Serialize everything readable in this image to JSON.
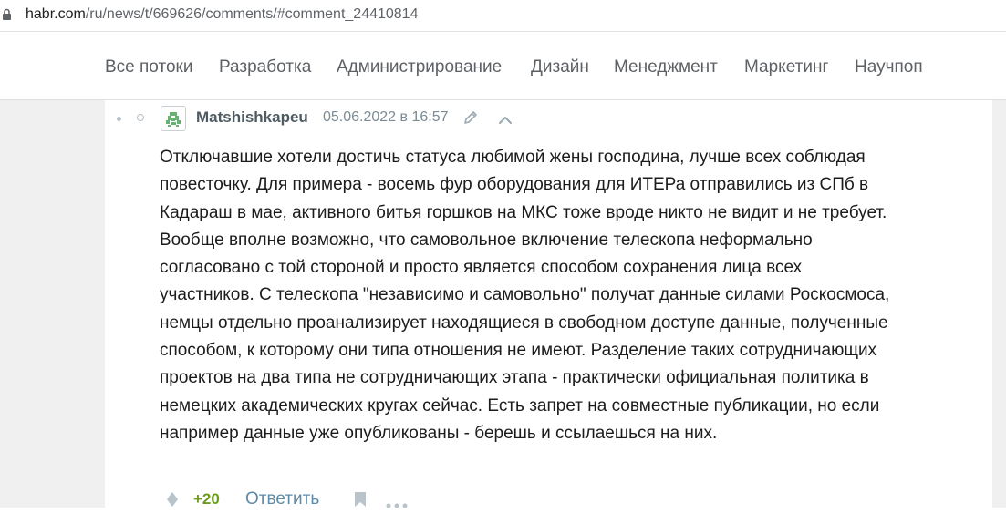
{
  "browser": {
    "url_host": "habr.com",
    "url_path": "/ru/news/t/669626/comments/#comment_24410814"
  },
  "nav": {
    "items": [
      {
        "label": "Все потоки"
      },
      {
        "label": "Разработка"
      },
      {
        "label": "Администрирование"
      },
      {
        "label": "Дизайн"
      },
      {
        "label": "Менеджмент"
      },
      {
        "label": "Маркетинг"
      },
      {
        "label": "Научпоп"
      }
    ]
  },
  "comment": {
    "author": "Matshishkapeu",
    "date": "05.06.2022 в 16:57",
    "text": "Отключавшие хотели достичь статуса любимой жены господина, лучше всех соблюдая\nповесточку. Для примера - восемь фур оборудования для ИТЕРа отправились из СПб в\nКадараш в мае, активного битья горшков на МКС тоже вроде никто не видит и не требует.\nВообще вполне возможно, что самовольное включение телескопа неформально\nсогласовано с той стороной и просто является способом сохранения лица всех\nучастников. С телескопа \"независимо и самовольно\" получат данные силами Роскосмоса,\nнемцы отдельно проанализирует находящиеся в свободном доступе данные, полученные\nспособом, к которому они типа отношения не имеют. Разделение таких сотрудничающих\nпроектов на два типа не сотрудничающих этапа - практически официальная политика в\nнемецких академических кругах сейчас. Есть запрет на совместные публикации, но если\nнапример данные уже опубликованы - берешь и ссылаешься на них.",
    "score": "+20",
    "reply_label": "Ответить"
  },
  "icons": {
    "lock": "lock-icon",
    "avatar": "avatar-identicon",
    "edit": "pencil-icon",
    "parent": "chevron-up-icon",
    "vote": "vote-diamond-icon",
    "bookmark": "bookmark-icon",
    "more": "more-dots-icon"
  },
  "colors": {
    "score_positive": "#6d9b1e",
    "reply_link": "#5e8aa8",
    "author": "#4f5b63",
    "page_bg": "#f0f0f0"
  }
}
